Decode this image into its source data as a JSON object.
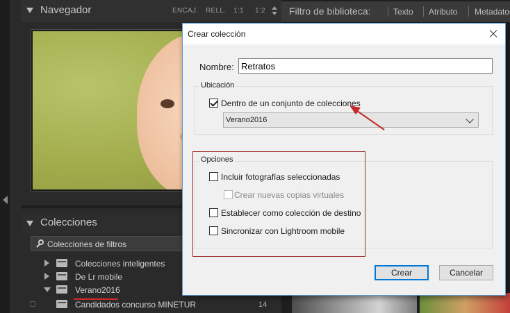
{
  "navigator": {
    "title": "Navegador",
    "zoom_options": [
      "ENCAJ.",
      "RELL.",
      "1:1",
      "1:2"
    ]
  },
  "collections": {
    "title": "Colecciones",
    "filter_label": "Colecciones de filtros",
    "rows": [
      {
        "label": "Colecciones inteligentes",
        "expanded": false
      },
      {
        "label": "De Lr mobile",
        "expanded": false
      },
      {
        "label": "Verano2016",
        "expanded": true
      },
      {
        "label": "Candidados concurso MINETUR",
        "count": "14"
      }
    ]
  },
  "library_filter": {
    "title": "Filtro de biblioteca:",
    "items": [
      "Texto",
      "Atributo",
      "Metadatos"
    ]
  },
  "dialog": {
    "title": "Crear colección",
    "name_label": "Nombre:",
    "name_value": "Retratos",
    "location_group": "Ubicación",
    "inside_set_label": "Dentro de un conjunto de colecciones",
    "inside_set_checked": true,
    "set_dropdown_value": "Verano2016",
    "options_group": "Opciones",
    "include_selected_label": "Incluir fotografías seleccionadas",
    "create_virtual_copies_label": "Crear nuevas copias virtuales",
    "set_as_target_label": "Establecer como colección de destino",
    "sync_lightroom_label": "Sincronizar con Lightroom mobile",
    "create_button": "Crear",
    "cancel_button": "Cancelar"
  },
  "colors": {
    "annotation_red": "#d42a2a",
    "primary_button_border": "#0078d7"
  }
}
